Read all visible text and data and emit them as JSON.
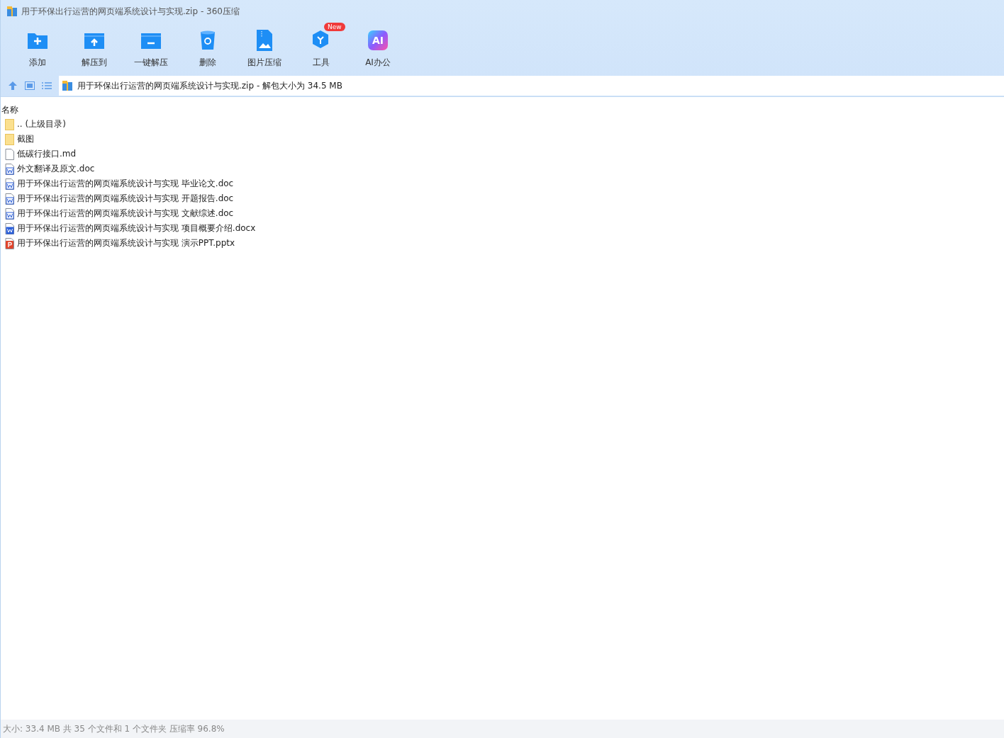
{
  "window": {
    "title": "用于环保出行运营的网页端系统设计与实现.zip - 360压缩"
  },
  "toolbar": [
    {
      "kind": "add",
      "label": "添加"
    },
    {
      "kind": "extract",
      "label": "解压到"
    },
    {
      "kind": "oneclick",
      "label": "一键解压"
    },
    {
      "kind": "delete",
      "label": "删除"
    },
    {
      "kind": "image",
      "label": "图片压缩"
    },
    {
      "kind": "tools",
      "label": "工具",
      "badge": "New"
    },
    {
      "kind": "ai",
      "label": "AI办公",
      "glyph": "AI"
    }
  ],
  "address_bar": {
    "path": "用于环保出行运营的网页端系统设计与实现.zip - 解包大小为 34.5 MB"
  },
  "table": {
    "columns": [
      "名称"
    ],
    "rows": [
      {
        "kind": "folder",
        "name": ".. (上级目录)"
      },
      {
        "kind": "folder",
        "name": "截图"
      },
      {
        "kind": "file",
        "name": "低碳行接口.md"
      },
      {
        "kind": "doc",
        "name": "外文翻译及原文.doc"
      },
      {
        "kind": "doc",
        "name": "用于环保出行运营的网页端系统设计与实现 毕业论文.doc"
      },
      {
        "kind": "doc",
        "name": "用于环保出行运营的网页端系统设计与实现 开题报告.doc"
      },
      {
        "kind": "doc",
        "name": "用于环保出行运营的网页端系统设计与实现 文献综述.doc"
      },
      {
        "kind": "docx",
        "name": "用于环保出行运营的网页端系统设计与实现 项目概要介绍.docx"
      },
      {
        "kind": "ppt",
        "name": "用于环保出行运营的网页端系统设计与实现 演示PPT.pptx"
      }
    ]
  },
  "status_bar": {
    "text": "大小: 33.4 MB 共 35 个文件和 1 个文件夹 压缩率 96.8%"
  }
}
